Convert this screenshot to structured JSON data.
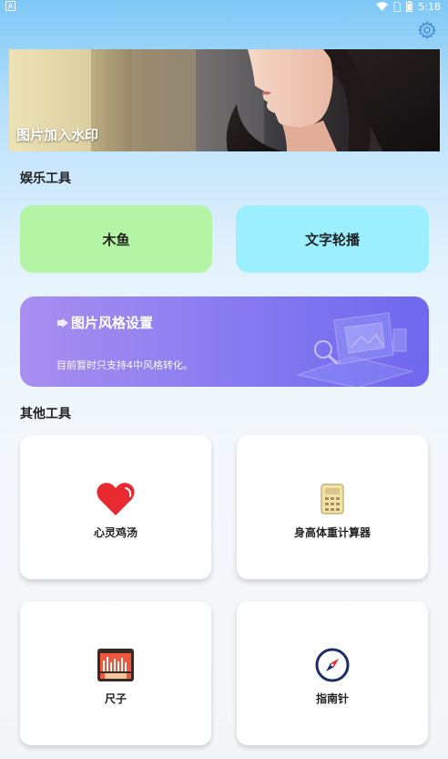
{
  "status_bar": {
    "time": "5:18"
  },
  "banner": {
    "title": "图片加入水印"
  },
  "entertainment": {
    "section_title": "娱乐工具",
    "tools": [
      {
        "label": "木鱼",
        "color": "#b3f5a5"
      },
      {
        "label": "文字轮播",
        "color": "#9cefff"
      }
    ]
  },
  "style_card": {
    "title": "图片风格设置",
    "description": "目前暂时只支持4中风格转化。"
  },
  "other": {
    "section_title": "其他工具",
    "tools": [
      {
        "label": "心灵鸡汤",
        "icon": "heart-icon"
      },
      {
        "label": "身高体重计算器",
        "icon": "calculator-icon"
      },
      {
        "label": "尺子",
        "icon": "ruler-icon"
      },
      {
        "label": "指南针",
        "icon": "compass-icon"
      }
    ]
  },
  "colors": {
    "accent_purple": "#7d6ff0",
    "heart_red": "#e8292f"
  }
}
